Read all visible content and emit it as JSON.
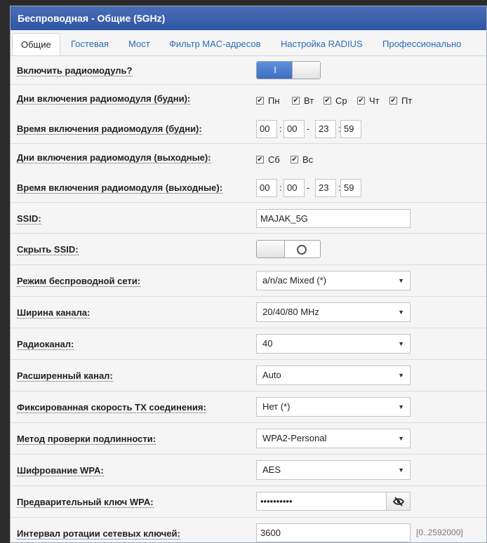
{
  "header": {
    "title": "Беспроводная - Общие (5GHz)"
  },
  "tabs": [
    {
      "label": "Общие"
    },
    {
      "label": "Гостевая"
    },
    {
      "label": "Мост"
    },
    {
      "label": "Фильтр MAC-адресов"
    },
    {
      "label": "Настройка RADIUS"
    },
    {
      "label": "Профессионально"
    }
  ],
  "radio": {
    "label": "Включить радиомодуль?",
    "on_text": "I"
  },
  "weekdays": {
    "label": "Дни включения радиомодуля (будни):",
    "days": [
      "Пн",
      "Вт",
      "Ср",
      "Чт",
      "Пт"
    ],
    "check": "✔"
  },
  "weekday_time": {
    "label": "Время включения радиомодуля (будни):",
    "start_h": "00",
    "start_m": "00",
    "end_h": "23",
    "end_m": "59",
    "colon": ":",
    "dash": "-"
  },
  "weekend": {
    "label": "Дни включения радиомодуля (выходные):",
    "days": [
      "Сб",
      "Вс"
    ],
    "check": "✔"
  },
  "weekend_time": {
    "label": "Время включения радиомодуля (выходные):",
    "start_h": "00",
    "start_m": "00",
    "end_h": "23",
    "end_m": "59"
  },
  "ssid": {
    "label": "SSID:",
    "value": "MAJAK_5G"
  },
  "hide_ssid": {
    "label": "Скрыть SSID:"
  },
  "wireless_mode": {
    "label": "Режим беспроводной сети:",
    "value": "a/n/ac Mixed (*)"
  },
  "channel_width": {
    "label": "Ширина канала:",
    "value": "20/40/80 MHz"
  },
  "channel": {
    "label": "Радиоканал:",
    "value": "40"
  },
  "ext_channel": {
    "label": "Расширенный канал:",
    "value": "Auto"
  },
  "tx_rate": {
    "label": "Фиксированная скорость TX соединения:",
    "value": "Нет (*)"
  },
  "auth": {
    "label": "Метод проверки подлинности:",
    "value": "WPA2-Personal"
  },
  "wpa_enc": {
    "label": "Шифрование WPA:",
    "value": "AES"
  },
  "psk": {
    "label": "Предварительный ключ WPA:",
    "value": "••••••••••"
  },
  "rekey": {
    "label": "Интервал ротации сетевых ключей:",
    "value": "3600",
    "hint": "[0..2592000]"
  },
  "select_arrow": "▼"
}
